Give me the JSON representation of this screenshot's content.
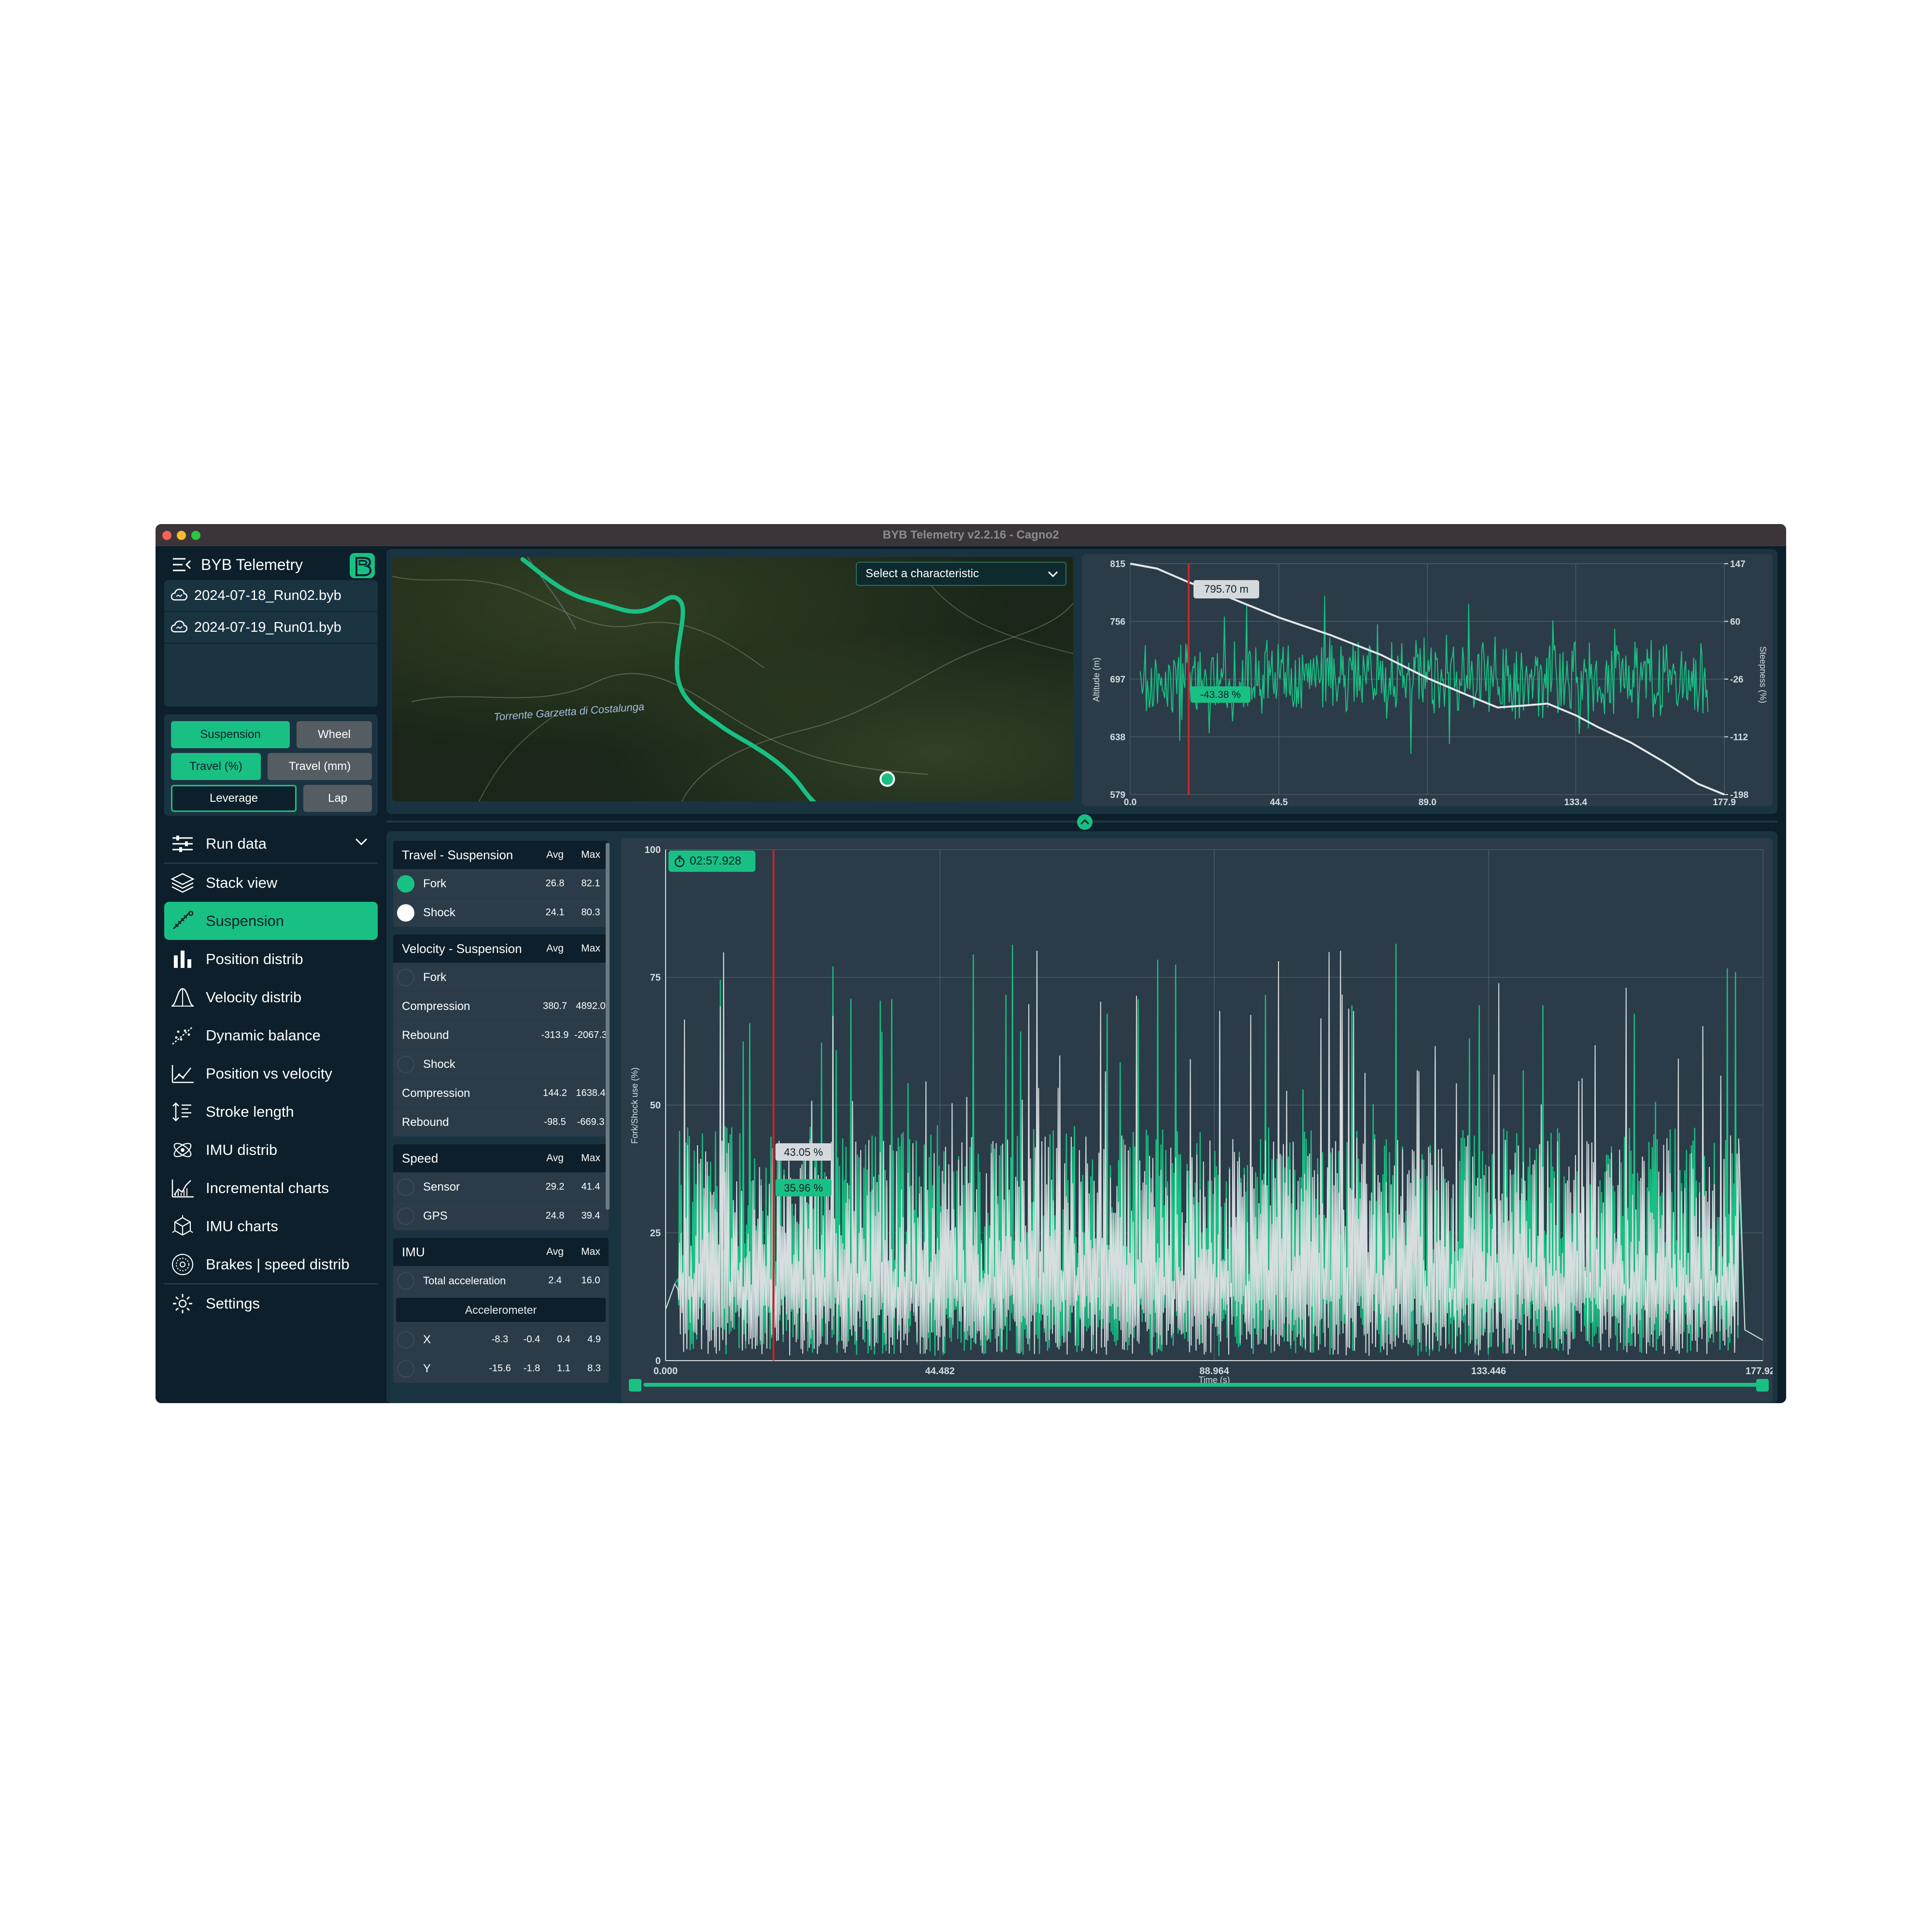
{
  "window": {
    "title": "BYB Telemetry v2.2.16 - Cagno2",
    "traffic_colors": [
      "#ff5f57",
      "#febc2e",
      "#28c840"
    ]
  },
  "app": {
    "name": "BYB Telemetry",
    "accent": "#19c084",
    "bg": "#0c1f2a",
    "panel": "#1a3341",
    "chart_bg": "#2b3c48"
  },
  "files": [
    {
      "name": "2024-07-18_Run02.byb",
      "icon": "cloud-file-icon"
    },
    {
      "name": "2024-07-19_Run01.byb",
      "icon": "cloud-file-icon"
    }
  ],
  "toggles": {
    "suspension": "Suspension",
    "wheel": "Wheel",
    "travel_pct": "Travel (%)",
    "travel_mm": "Travel (mm)",
    "leverage": "Leverage",
    "lap": "Lap"
  },
  "nav": [
    {
      "label": "Run data",
      "icon": "sliders-icon",
      "expandable": true
    },
    {
      "label": "Stack view",
      "icon": "layers-icon"
    },
    {
      "label": "Suspension",
      "icon": "suspension-icon",
      "active": true
    },
    {
      "label": "Position distrib",
      "icon": "bar-chart-icon"
    },
    {
      "label": "Velocity distrib",
      "icon": "bell-curve-icon"
    },
    {
      "label": "Dynamic balance",
      "icon": "scatter-icon"
    },
    {
      "label": "Position vs velocity",
      "icon": "trend-icon"
    },
    {
      "label": "Stroke length",
      "icon": "stroke-icon"
    },
    {
      "label": "IMU distrib",
      "icon": "orbit-icon"
    },
    {
      "label": "Incremental charts",
      "icon": "area-chart-icon"
    },
    {
      "label": "IMU charts",
      "icon": "cube-icon"
    },
    {
      "label": "Brakes | speed distrib",
      "icon": "disc-icon"
    },
    {
      "label": "Settings",
      "icon": "gear-icon"
    }
  ],
  "map": {
    "select_placeholder": "Select a characteristic",
    "label": "Torrente Garzetta di Costalunga"
  },
  "stats": {
    "avg": "Avg",
    "max": "Max",
    "travel": {
      "title": "Travel - Suspension",
      "rows": [
        {
          "label": "Fork",
          "avg": "26.8",
          "max": "82.1",
          "dot": "#19c084"
        },
        {
          "label": "Shock",
          "avg": "24.1",
          "max": "80.3",
          "dot": "#ffffff"
        }
      ]
    },
    "velocity": {
      "title": "Velocity - Suspension",
      "rows": [
        {
          "label": "Fork",
          "avg": "",
          "max": "",
          "dot": "none"
        },
        {
          "label": "Compression",
          "avg": "380.7",
          "max": "4892.0"
        },
        {
          "label": "Rebound",
          "avg": "-313.9",
          "max": "-2067.3"
        },
        {
          "label": "Shock",
          "avg": "",
          "max": "",
          "dot": "none"
        },
        {
          "label": "Compression",
          "avg": "144.2",
          "max": "1638.4"
        },
        {
          "label": "Rebound",
          "avg": "-98.5",
          "max": "-669.3"
        }
      ]
    },
    "speed": {
      "title": "Speed",
      "rows": [
        {
          "label": "Sensor",
          "avg": "29.2",
          "max": "41.4"
        },
        {
          "label": "GPS",
          "avg": "24.8",
          "max": "39.4"
        }
      ]
    },
    "imu": {
      "title": "IMU",
      "total": {
        "label": "Total acceleration",
        "avg": "2.4",
        "max": "16.0"
      },
      "sub": "Accelerometer",
      "rows": [
        {
          "label": "X",
          "v1": "-8.3",
          "v2": "-0.4",
          "v3": "0.4",
          "v4": "4.9"
        },
        {
          "label": "Y",
          "v1": "-15.6",
          "v2": "-1.8",
          "v3": "1.1",
          "v4": "8.3"
        }
      ]
    }
  },
  "timer": "02:57.928",
  "chart_data": [
    {
      "type": "line",
      "id": "altitude-steepness",
      "ylabel": "Altitude (m)",
      "y2label": "Steepness (%)",
      "x_ticks": [
        "0.0",
        "44.5",
        "89.0",
        "133.4",
        "177.9"
      ],
      "y_ticks": [
        "815",
        "756",
        "697",
        "638",
        "579"
      ],
      "y2_ticks": [
        "147",
        "60",
        "-26",
        "-112",
        "-198"
      ],
      "ylim": [
        579,
        815
      ],
      "y2lim": [
        -198,
        147
      ],
      "xlim": [
        0,
        177.9
      ],
      "cursor": {
        "x": 17.5,
        "altitude_label": "795.70 m",
        "steepness_label": "-43.38 %"
      },
      "series": [
        {
          "name": "Altitude",
          "color": "#e6e9ec",
          "x": [
            0,
            8,
            17.5,
            30,
            44.5,
            60,
            75,
            89,
            100,
            110,
            118,
            125,
            133.4,
            140,
            150,
            160,
            170,
            177.9
          ],
          "y": [
            815,
            810,
            796,
            780,
            760,
            742,
            722,
            698,
            682,
            668,
            670,
            672,
            660,
            648,
            632,
            612,
            590,
            579
          ]
        },
        {
          "name": "Steepness",
          "color": "#19c084"
        }
      ]
    },
    {
      "type": "line",
      "id": "fork-shock-travel",
      "ylabel": "Fork/Shock use (%)",
      "xlabel": "Time (s)",
      "x_ticks": [
        "0.000",
        "44.482",
        "88.964",
        "133.446",
        "177.928"
      ],
      "y_ticks": [
        "100",
        "75",
        "50",
        "25",
        "0"
      ],
      "xlim": [
        0,
        177.928
      ],
      "ylim": [
        0,
        100
      ],
      "cursor": {
        "x": 17.5,
        "fork_label": "35.96 %",
        "shock_label": "43.05 %"
      },
      "series": [
        {
          "name": "Fork",
          "color": "#19c084",
          "avg": 26.8,
          "max": 82.1
        },
        {
          "name": "Shock",
          "color": "#d8dde0",
          "avg": 24.1,
          "max": 80.3
        }
      ]
    }
  ]
}
